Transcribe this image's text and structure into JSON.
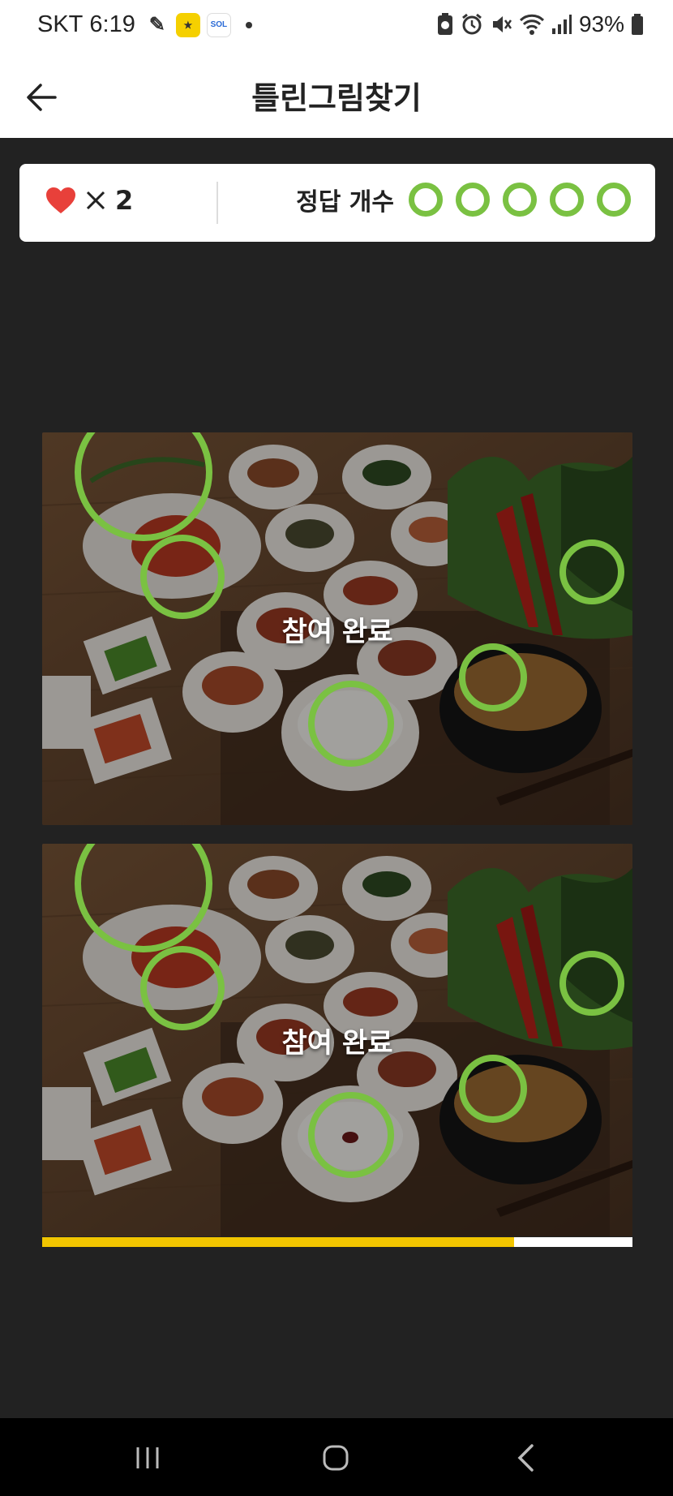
{
  "status": {
    "carrier": "SKT",
    "time": "6:19",
    "app_icons": [
      "pen-icon",
      "yellow-app-icon",
      "sol-bank-icon"
    ],
    "battery": "93%"
  },
  "header": {
    "title": "틀린그림찾기"
  },
  "score": {
    "heart_count": "2",
    "answer_label": "정답 개수",
    "answers_found": 5
  },
  "game": {
    "completed_label_top": "참여 완료",
    "completed_label_bottom": "참여 완료"
  },
  "progress": {
    "value": 0.8
  },
  "colors": {
    "accent_green": "#7ac142",
    "heart_red": "#e8403a",
    "progress_yellow": "#f2c500"
  }
}
